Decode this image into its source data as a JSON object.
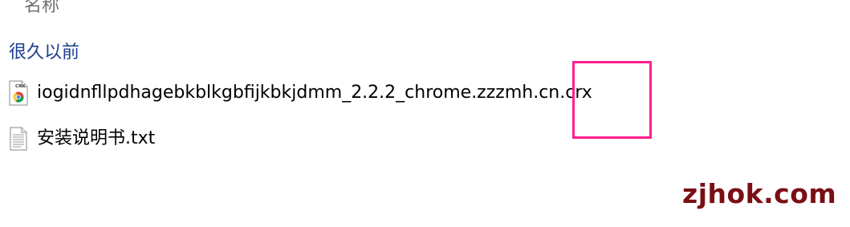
{
  "list": {
    "column_header": "名称",
    "group_label": "很久以前",
    "files": [
      {
        "name": "iogidnfllpdhagebkblkgbfijkbkjdmm_2.2.2_chrome.zzzmh.cn.crx",
        "icon": "crx-file-icon",
        "icon_badge": "CRX"
      },
      {
        "name": "安装说明书.txt",
        "icon": "text-file-icon"
      }
    ]
  },
  "annotation": {
    "highlight_color": "#ff1f8e"
  },
  "watermark": {
    "text": "zjhok.com",
    "color": "#7a0f14"
  }
}
